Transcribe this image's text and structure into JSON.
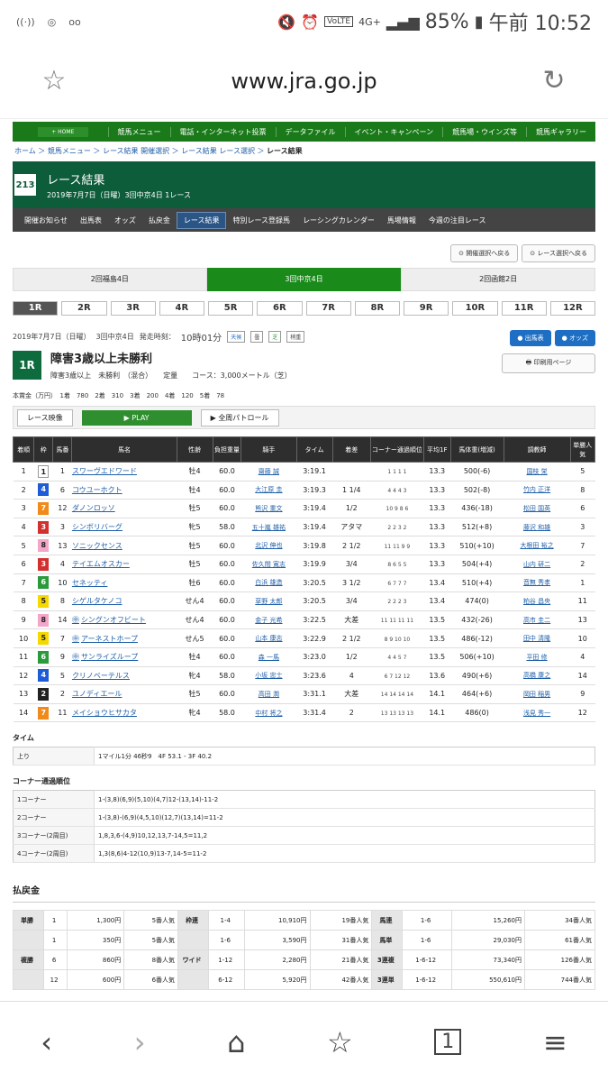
{
  "status": {
    "left_icons": [
      "wifi-call-on",
      "app-icon",
      "voicemail-on"
    ],
    "battery": "85%",
    "time": "午前 10:52",
    "network": "4G+",
    "volte": "VoLTE"
  },
  "browser": {
    "url": "www.jra.go.jp"
  },
  "global_nav": {
    "home": "+ HOME",
    "items": [
      "競馬メニュー",
      "電話・インターネット投票",
      "データファイル",
      "イベント・キャンペーン",
      "競馬場・ウインズ等",
      "競馬ギャラリー"
    ]
  },
  "breadcrumb": [
    "ホーム",
    "競馬メニュー",
    "レース結果 開催選択",
    "レース結果 レース選択",
    "レース結果"
  ],
  "header": {
    "logo": "213",
    "title": "レース結果",
    "subtitle": "2019年7月7日（日曜）3回中京4日 1レース"
  },
  "sub_nav": {
    "items": [
      "開催お知らせ",
      "出馬表",
      "オッズ",
      "払戻金",
      "レース結果",
      "特別レース登録馬",
      "レーシングカレンダー",
      "馬場情報",
      "今週の注目レース"
    ],
    "active": 4
  },
  "top_buttons": [
    "開催選択へ戻る",
    "レース選択へ戻る"
  ],
  "days": {
    "items": [
      "2回福島4日",
      "3回中京4日",
      "2回函館2日"
    ],
    "active": 1
  },
  "races": {
    "items": [
      "1R",
      "2R",
      "3R",
      "4R",
      "5R",
      "6R",
      "7R",
      "8R",
      "9R",
      "10R",
      "11R",
      "12R"
    ],
    "active": 0
  },
  "race": {
    "date": "2019年7月7日（日曜）",
    "meeting": "3回中京4日",
    "start_label": "発走時刻：",
    "start_time": "10時01分",
    "tenki_label": "天候",
    "tenki": "曇",
    "baba_label": "芝",
    "baba": "稍重",
    "badge": "1R",
    "name": "障害3歳以上未勝利",
    "conditions": "障害3歳以上　未勝利　（混合）　　定量　　コース：3,000メートル（芝）",
    "prize": "本賞金（万円）　1着　780　2着　310　3着　200　4着　120　5着　78"
  },
  "side_buttons": {
    "shutuba": "出馬表",
    "odds": "オッズ",
    "print": "印刷用ページ"
  },
  "video": {
    "label": "レース映像",
    "play": "PLAY",
    "patrol": "全周パトロール"
  },
  "result_headers": [
    "着順",
    "枠",
    "馬番",
    "馬名",
    "性齢",
    "負担重量",
    "騎手",
    "タイム",
    "着差",
    "コーナー通過順位",
    "平均1F",
    "馬体重(増減)",
    "調教師",
    "単勝人気"
  ],
  "results": [
    [
      "1",
      "1",
      "1",
      "スワーヴエドワード",
      "牡4",
      "60.0",
      "齋藤 誠",
      "3:19.1",
      "",
      "1 1 1 1",
      "13.3",
      "500(-6)",
      "国枝 栄",
      "5"
    ],
    [
      "2",
      "4",
      "6",
      "コウユーホクト",
      "牡4",
      "60.0",
      "大江原 圭",
      "3:19.3",
      "1 1/4",
      "4 4 4 3",
      "13.3",
      "502(-8)",
      "竹内 正洋",
      "8"
    ],
    [
      "3",
      "7",
      "12",
      "ダノンロッソ",
      "牡5",
      "60.0",
      "熊沢 重文",
      "3:19.4",
      "1/2",
      "10 9 8 6",
      "13.3",
      "436(-18)",
      "松田 国英",
      "6"
    ],
    [
      "4",
      "3",
      "3",
      "シンボリバーグ",
      "牝5",
      "58.0",
      "五十嵐 雄祐",
      "3:19.4",
      "アタマ",
      "2 2 3 2",
      "13.3",
      "512(+8)",
      "藤沢 和雄",
      "3"
    ],
    [
      "5",
      "8",
      "13",
      "ソニックセンス",
      "牡5",
      "60.0",
      "北沢 伸也",
      "3:19.8",
      "2 1/2",
      "11 11 9 9",
      "13.3",
      "510(+10)",
      "大根田 裕之",
      "7"
    ],
    [
      "6",
      "3",
      "4",
      "テイエムオスカー",
      "牡5",
      "60.0",
      "佐久間 寛志",
      "3:19.9",
      "3/4",
      "8 6 5 5",
      "13.3",
      "504(+4)",
      "山内 研二",
      "2"
    ],
    [
      "7",
      "6",
      "10",
      "セネッティ",
      "牡6",
      "60.0",
      "白浜 雄造",
      "3:20.5",
      "3 1/2",
      "6 7 7 7",
      "13.4",
      "510(+4)",
      "音無 秀孝",
      "1"
    ],
    [
      "8",
      "5",
      "8",
      "シゲルタケノコ",
      "せん4",
      "60.0",
      "草野 太郎",
      "3:20.5",
      "3/4",
      "2 2 2 3",
      "13.4",
      "474(0)",
      "粕谷 昌央",
      "11"
    ],
    [
      "9",
      "8",
      "14",
      "シングンオフビート",
      "せん4",
      "60.0",
      "金子 光希",
      "3:22.5",
      "大差",
      "11 11 11 11",
      "13.5",
      "432(-26)",
      "高市 圭二",
      "13"
    ],
    [
      "10",
      "5",
      "7",
      "アーネストホープ",
      "せん5",
      "60.0",
      "山本 康志",
      "3:22.9",
      "2 1/2",
      "8 9 10 10",
      "13.5",
      "486(-12)",
      "田中 清隆",
      "10"
    ],
    [
      "11",
      "6",
      "9",
      "サンライズループ",
      "牡4",
      "60.0",
      "森 一馬",
      "3:23.0",
      "1/2",
      "4 4 5 7",
      "13.5",
      "506(+10)",
      "平田 修",
      "4"
    ],
    [
      "12",
      "4",
      "5",
      "クリノベーテルス",
      "牝4",
      "58.0",
      "小坂 忠士",
      "3:23.6",
      "4",
      "6 7 12 12",
      "13.6",
      "490(+6)",
      "高橋 康之",
      "14"
    ],
    [
      "13",
      "2",
      "2",
      "ユノディエール",
      "牡5",
      "60.0",
      "高田 潤",
      "3:31.1",
      "大差",
      "14 14 14 14",
      "14.1",
      "464(+6)",
      "岡田 稲男",
      "9"
    ],
    [
      "14",
      "7",
      "11",
      "メイショウヒサカタ",
      "牝4",
      "58.0",
      "中村 将之",
      "3:31.4",
      "2",
      "13 13 13 13",
      "14.1",
      "486(0)",
      "浅見 秀一",
      "12"
    ]
  ],
  "waku_colors": {
    "1": "#ffffff",
    "2": "#222222",
    "3": "#d32f2f",
    "4": "#1e5bd6",
    "5": "#f4d800",
    "6": "#2a9a3a",
    "7": "#f08a1a",
    "8": "#f4a6c8"
  },
  "marks": {
    "8": "マル外",
    "9": "マル外",
    "10": "マル外"
  },
  "time_section": {
    "title": "タイム",
    "label": "上り",
    "value": "1マイル1分 46秒9　4F 53.1 - 3F 40.2"
  },
  "corner_section": {
    "title": "コーナー通過順位",
    "rows": [
      [
        "1コーナー",
        "1-(3,8)(6,9)(5,10)(4,7)12-(13,14)-11-2"
      ],
      [
        "2コーナー",
        "1-(3,8)-(6,9)(4,5,10)(12,7)(13,14)=11-2"
      ],
      [
        "3コーナー(2周目)",
        "1,8,3,6-(4,9)10,12,13,7-14,5=11,2"
      ],
      [
        "4コーナー(2周目)",
        "1,3(8,6)4-12(10,9)13-7,14-5=11-2"
      ]
    ]
  },
  "payout": {
    "title": "払戻金",
    "rows": [
      [
        "単勝",
        "1",
        "1,300円",
        "5番人気",
        "枠連",
        "1-4",
        "10,910円",
        "19番人気",
        "馬連",
        "1-6",
        "15,260円",
        "34番人気"
      ],
      [
        "",
        "1",
        "350円",
        "5番人気",
        "",
        "1-6",
        "3,590円",
        "31番人気",
        "馬単",
        "1-6",
        "29,030円",
        "61番人気"
      ],
      [
        "複勝",
        "6",
        "860円",
        "8番人気",
        "ワイド",
        "1-12",
        "2,280円",
        "21番人気",
        "3連複",
        "1-6-12",
        "73,340円",
        "126番人気"
      ],
      [
        "",
        "12",
        "600円",
        "6番人気",
        "",
        "6-12",
        "5,920円",
        "42番人気",
        "3連単",
        "1-6-12",
        "550,610円",
        "744番人気"
      ]
    ]
  },
  "bottom_nav": [
    "back",
    "forward",
    "home",
    "bookmark-star",
    "tabs",
    "menu"
  ]
}
